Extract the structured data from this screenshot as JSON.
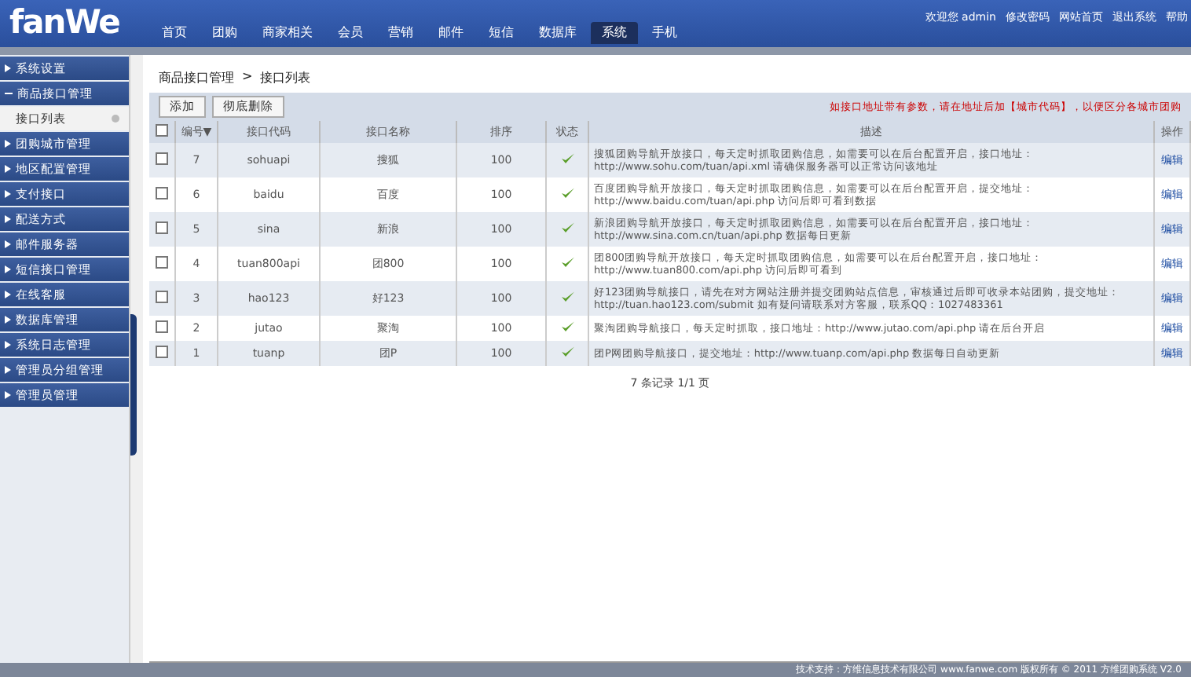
{
  "header": {
    "logo": "fanWe",
    "user_links": [
      "欢迎您 admin",
      "修改密码",
      "网站首页",
      "退出系统",
      "帮助"
    ]
  },
  "nav": [
    {
      "label": "首页",
      "selected": false
    },
    {
      "label": "团购",
      "selected": false
    },
    {
      "label": "商家相关",
      "selected": false
    },
    {
      "label": "会员",
      "selected": false
    },
    {
      "label": "营销",
      "selected": false
    },
    {
      "label": "邮件",
      "selected": false
    },
    {
      "label": "短信",
      "selected": false
    },
    {
      "label": "数据库",
      "selected": false
    },
    {
      "label": "系统",
      "selected": true
    },
    {
      "label": "手机",
      "selected": false
    }
  ],
  "sidebar": {
    "items": [
      {
        "label": "系统设置",
        "expanded": false
      },
      {
        "label": "商品接口管理",
        "expanded": true,
        "children": [
          {
            "label": "接口列表",
            "selected": true
          }
        ]
      },
      {
        "label": "团购城市管理",
        "expanded": false
      },
      {
        "label": "地区配置管理",
        "expanded": false
      },
      {
        "label": "支付接口",
        "expanded": false
      },
      {
        "label": "配送方式",
        "expanded": false
      },
      {
        "label": "邮件服务器",
        "expanded": false
      },
      {
        "label": "短信接口管理",
        "expanded": false
      },
      {
        "label": "在线客服",
        "expanded": false
      },
      {
        "label": "数据库管理",
        "expanded": false
      },
      {
        "label": "系统日志管理",
        "expanded": false
      },
      {
        "label": "管理员分组管理",
        "expanded": false
      },
      {
        "label": "管理员管理",
        "expanded": false
      }
    ]
  },
  "breadcrumb": {
    "items": [
      "商品接口管理",
      "接口列表"
    ],
    "separator": ">"
  },
  "toolbar": {
    "buttons": [
      "添加",
      "彻底删除"
    ],
    "notice": "如接口地址带有参数，请在地址后加【城市代码】，以便区分各城市团购"
  },
  "table": {
    "select_all_checked": false,
    "columns": [
      "编号▼",
      "接口代码",
      "接口名称",
      "排序",
      "状态",
      "描述",
      "操作"
    ],
    "rows": [
      {
        "checked": false,
        "id": "7",
        "code": "sohuapi",
        "name": "搜狐",
        "sort": "100",
        "enabled": true,
        "description": "搜狐团购导航开放接口，每天定时抓取团购信息，如需要可以在后台配置开启，接口地址：http://www.sohu.com/tuan/api.xml 请确保服务器可以正常访问该地址",
        "action": "编辑"
      },
      {
        "checked": false,
        "id": "6",
        "code": "baidu",
        "name": "百度",
        "sort": "100",
        "enabled": true,
        "description": "百度团购导航开放接口，每天定时抓取团购信息，如需要可以在后台配置开启，提交地址：http://www.baidu.com/tuan/api.php 访问后即可看到数据",
        "action": "编辑"
      },
      {
        "checked": false,
        "id": "5",
        "code": "sina",
        "name": "新浪",
        "sort": "100",
        "enabled": true,
        "description": "新浪团购导航开放接口，每天定时抓取团购信息，如需要可以在后台配置开启，接口地址：http://www.sina.com.cn/tuan/api.php 数据每日更新",
        "action": "编辑"
      },
      {
        "checked": false,
        "id": "4",
        "code": "tuan800api",
        "name": "团800",
        "sort": "100",
        "enabled": true,
        "description": "团800团购导航开放接口，每天定时抓取团购信息，如需要可以在后台配置开启，接口地址：http://www.tuan800.com/api.php 访问后即可看到",
        "action": "编辑"
      },
      {
        "checked": false,
        "id": "3",
        "code": "hao123",
        "name": "好123",
        "sort": "100",
        "enabled": true,
        "description": "好123团购导航接口，请先在对方网站注册并提交团购站点信息，审核通过后即可收录本站团购，提交地址：http://tuan.hao123.com/submit 如有疑问请联系对方客服，联系QQ：1027483361",
        "action": "编辑"
      },
      {
        "checked": false,
        "id": "2",
        "code": "jutao",
        "name": "聚淘",
        "sort": "100",
        "enabled": true,
        "description": "聚淘团购导航接口，每天定时抓取，接口地址：http://www.jutao.com/api.php 请在后台开启",
        "action": "编辑"
      },
      {
        "checked": false,
        "id": "1",
        "code": "tuanp",
        "name": "团P",
        "sort": "100",
        "enabled": true,
        "description": "团P网团购导航接口，提交地址：http://www.tuanp.com/api.php 数据每日自动更新",
        "action": "编辑"
      }
    ]
  },
  "pager": "7 条记录 1/1 页",
  "footer": "技术支持：方维信息技术有限公司 www.fanwe.com 版权所有 © 2011 方维团购系统 V2.0"
}
